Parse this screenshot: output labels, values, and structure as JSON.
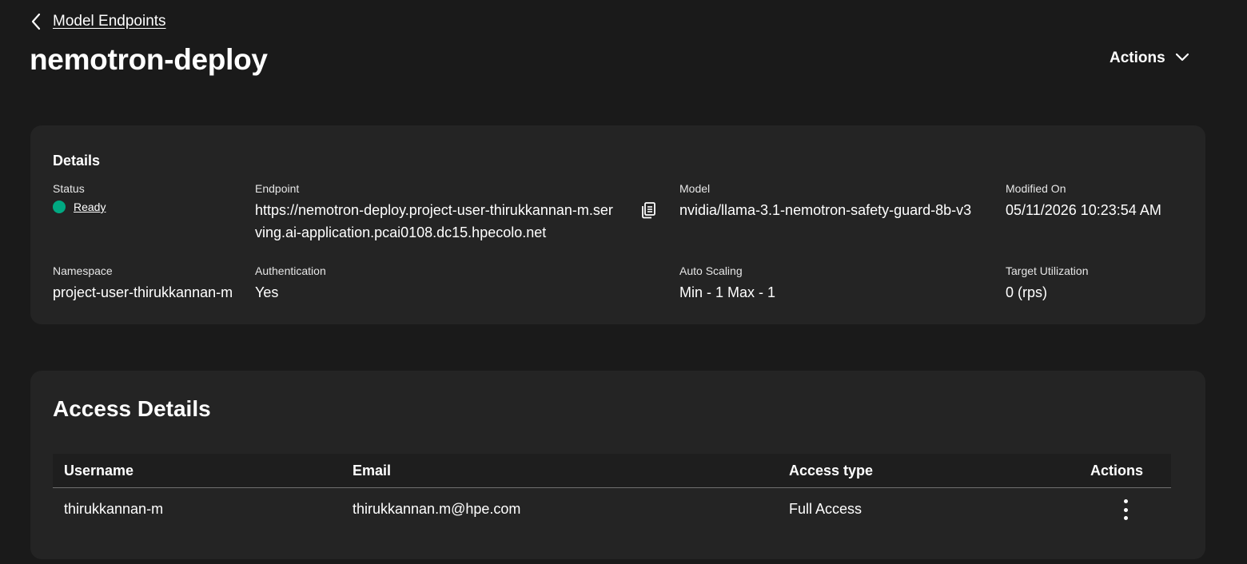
{
  "breadcrumb": {
    "back_label": "Model Endpoints"
  },
  "page": {
    "title": "nemotron-deploy",
    "actions_label": "Actions"
  },
  "details": {
    "heading": "Details",
    "status": {
      "label": "Status",
      "value": "Ready",
      "color": "#01a982"
    },
    "endpoint": {
      "label": "Endpoint",
      "value": "https://nemotron-deploy.project-user-thirukkannan-m.serving.ai-application.pcai0108.dc15.hpecolo.net"
    },
    "model": {
      "label": "Model",
      "value": "nvidia/llama-3.1-nemotron-safety-guard-8b-v3"
    },
    "modified_on": {
      "label": "Modified On",
      "value": "05/11/2026 10:23:54 AM"
    },
    "namespace": {
      "label": "Namespace",
      "value": "project-user-thirukkannan-m"
    },
    "authentication": {
      "label": "Authentication",
      "value": "Yes"
    },
    "auto_scaling": {
      "label": "Auto Scaling",
      "value": "Min - 1 Max - 1"
    },
    "target_utilization": {
      "label": "Target Utilization",
      "value": "0 (rps)"
    }
  },
  "access": {
    "heading": "Access Details",
    "columns": [
      "Username",
      "Email",
      "Access type",
      "Actions"
    ],
    "rows": [
      {
        "username": "thirukkannan-m",
        "email": "thirukkannan.m@hpe.com",
        "access_type": "Full Access"
      }
    ]
  }
}
